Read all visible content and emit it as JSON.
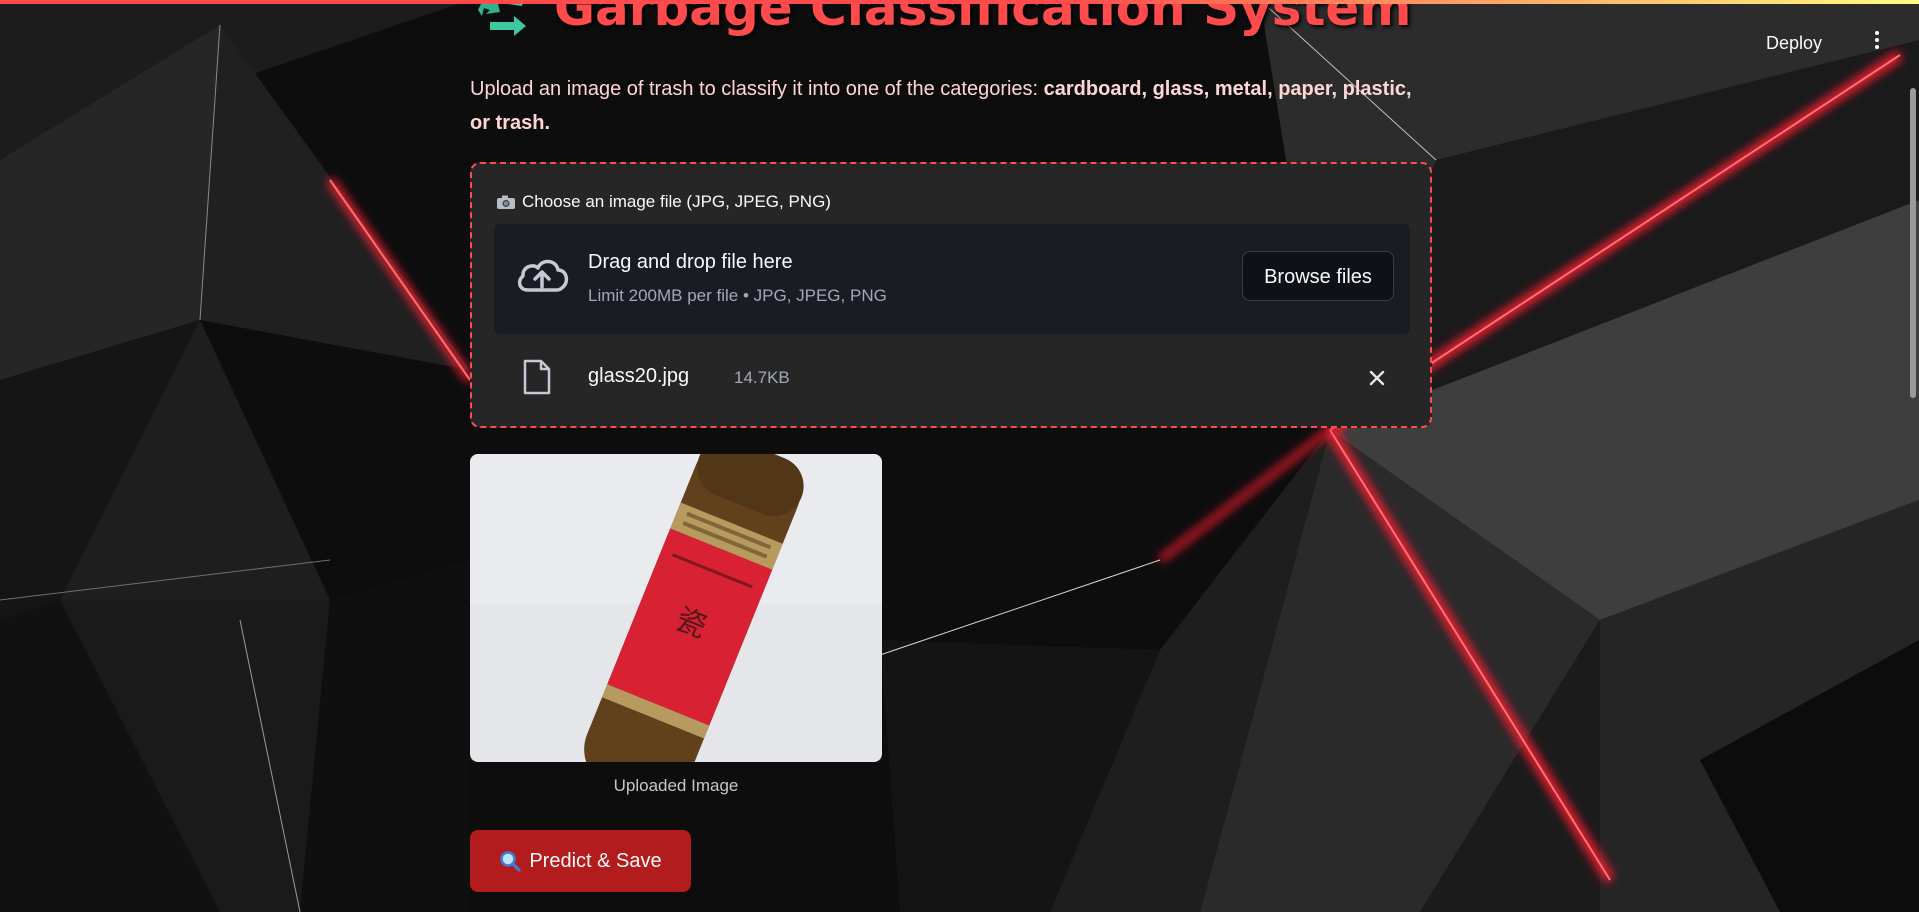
{
  "header": {
    "deploy_label": "Deploy",
    "menu_icon": "more-vertical-icon"
  },
  "main": {
    "title_icon": "recycle-icon",
    "title": "Garbage Classification System",
    "subtitle_prefix": "Upload an image of trash to classify it into one of the categories: ",
    "subtitle_categories": "cardboard, glass, metal, paper, plastic, or trash."
  },
  "uploader": {
    "label_icon": "camera-icon",
    "label": "Choose an image file (JPG, JPEG, PNG)",
    "drop_title": "Drag and drop file here",
    "drop_limit": "Limit 200MB per file • JPG, JPEG, PNG",
    "browse_label": "Browse files",
    "file": {
      "name": "glass20.jpg",
      "size": "14.7KB"
    }
  },
  "preview": {
    "caption": "Uploaded Image"
  },
  "actions": {
    "predict_label": "Predict & Save",
    "predict_icon": "magnifier-icon"
  },
  "colors": {
    "accent": "#ff4b4b",
    "button_red": "#b31c1c",
    "panel": "#262626",
    "dropzone": "#1a1c24"
  }
}
